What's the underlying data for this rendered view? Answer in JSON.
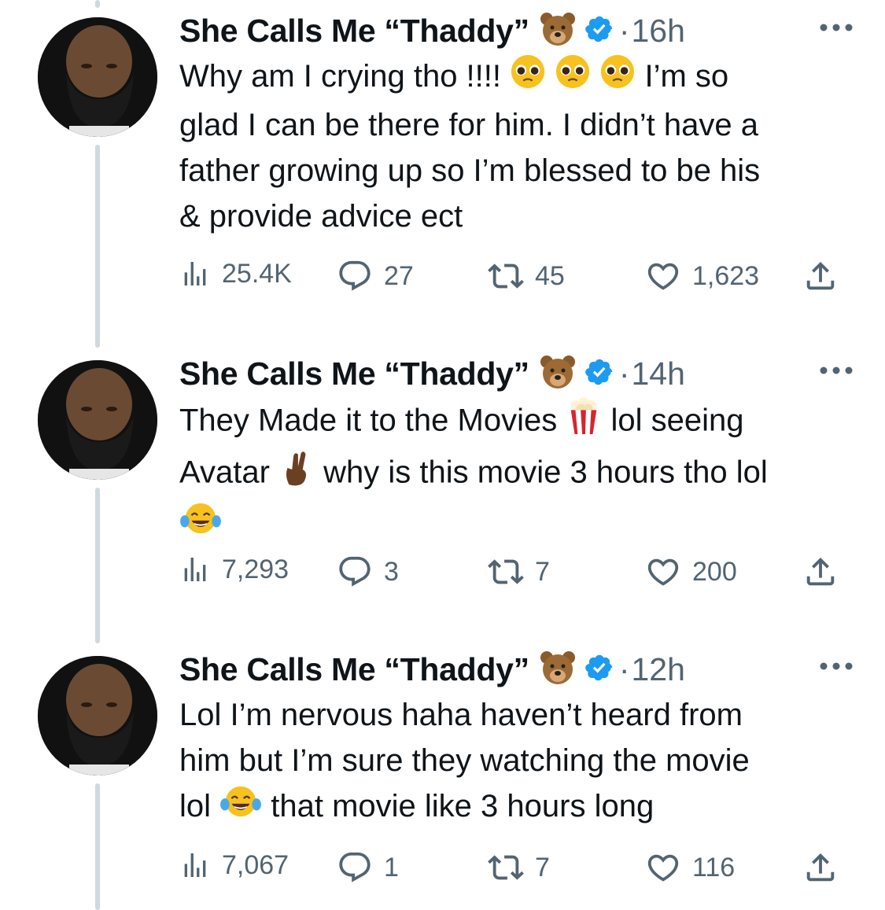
{
  "tweets": [
    {
      "display_name": "She Calls Me “Thaddy”",
      "time": "16h",
      "text_parts": [
        "Why am I crying tho !!!! ",
        " I’m so",
        "glad I can be there for him. I didn’t have a",
        "father growing up so I’m blessed to be his",
        "& provide advice ect"
      ],
      "views": "25.4K",
      "replies": "27",
      "retweets": "45",
      "likes": "1,623"
    },
    {
      "display_name": "She Calls Me “Thaddy”",
      "time": "14h",
      "text_parts": [
        "They Made it to the Movies ",
        " lol seeing",
        "Avatar ",
        " why is this movie 3 hours tho lol"
      ],
      "views": "7,293",
      "replies": "3",
      "retweets": "7",
      "likes": "200"
    },
    {
      "display_name": "She Calls Me “Thaddy”",
      "time": "12h",
      "text_parts": [
        "Lol I’m nervous haha haven’t heard from",
        "him but I’m sure they watching the movie",
        "lol ",
        " that movie like 3 hours long"
      ],
      "views": "7,067",
      "replies": "1",
      "retweets": "7",
      "likes": "116"
    }
  ],
  "icons": {
    "bear": "bear-face-emoji",
    "verified": "verified-badge-icon",
    "pleading": "pleading-face-emoji",
    "popcorn": "popcorn-emoji",
    "crossed_fingers": "crossed-fingers-emoji",
    "joy": "face-with-tears-of-joy-emoji"
  },
  "colors": {
    "verified": "#1d9bf0",
    "muted": "#536471",
    "thread_line": "#cfd9de"
  }
}
